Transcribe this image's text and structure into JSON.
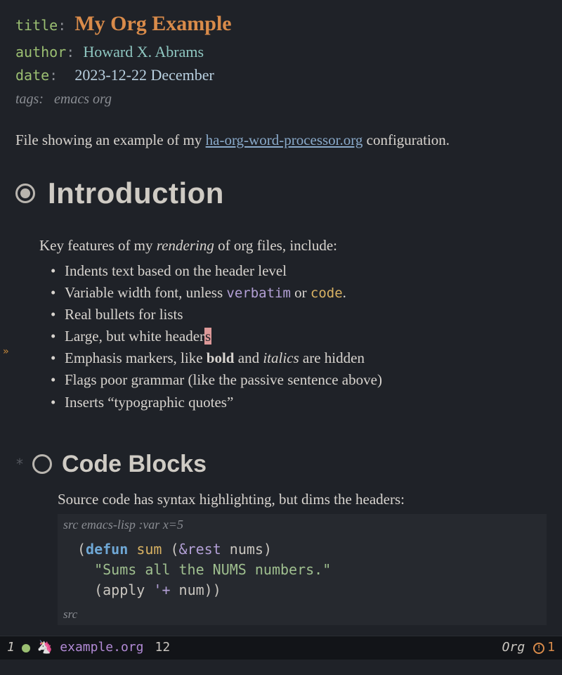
{
  "meta": {
    "title_key": "title",
    "title_val": "My Org Example",
    "author_key": "author",
    "author_val": "Howard X. Abrams",
    "date_key": "date",
    "date_val": "2023-12-22 December",
    "tags_key": "tags:",
    "tags_val": "emacs org"
  },
  "intro": {
    "pre": "File showing an example of my ",
    "link": "ha-org-word-processor.org",
    "post": " configuration."
  },
  "sections": {
    "s1": {
      "heading": "Introduction",
      "lead_pre": "Key features of my ",
      "lead_em": "rendering",
      "lead_post": " of org files, include:",
      "items": {
        "0": "Indents text based on the header level",
        "1_pre": "Variable width font, unless ",
        "1_verb": "verbatim",
        "1_mid": " or ",
        "1_code": "code",
        "1_post": ".",
        "2": "Real bullets for lists",
        "3_pre": "Large, but white header",
        "3_cursor": "s",
        "4_pre": "Emphasis markers, like ",
        "4_bold": "bold",
        "4_mid": " and ",
        "4_ital": "italics",
        "4_post": " are hidden",
        "5": "Flags poor grammar (like the passive sentence above)",
        "6": "Inserts “typographic quotes”"
      }
    },
    "s2": {
      "heading": "Code Blocks",
      "lead": "Source code has syntax highlighting, but dims the headers:",
      "src_header_pre": "src ",
      "src_header_lang": "emacs-lisp :var x=5",
      "code": {
        "l1_kw": "defun",
        "l1_fn": "sum",
        "l1_amp": "&rest",
        "l1_arg": "nums",
        "l2_str": "\"Sums all the NUMS numbers.\"",
        "l3_fn": "apply",
        "l3_q": "'+",
        "l3_arg": "num"
      },
      "src_footer": "src"
    }
  },
  "modeline": {
    "win_num": "1",
    "filename": "example.org",
    "line": "12",
    "mode": "Org",
    "warn_count": "1"
  }
}
